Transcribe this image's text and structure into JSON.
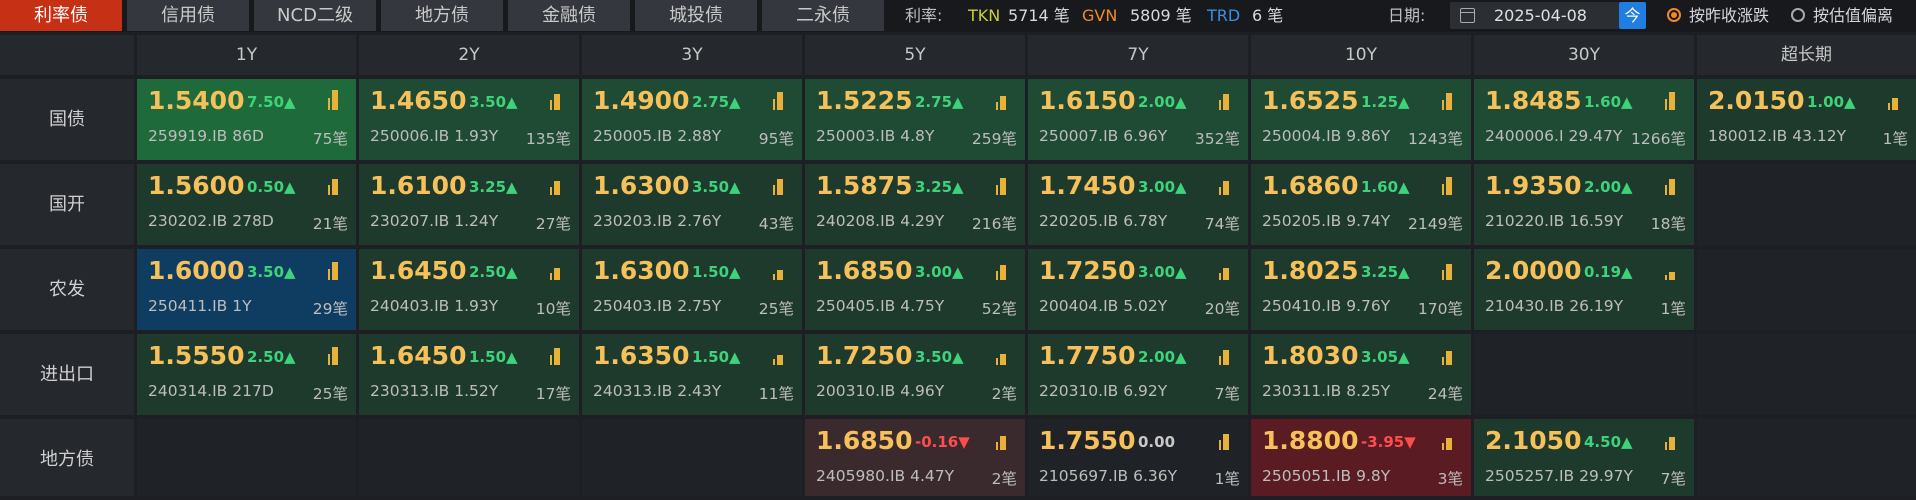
{
  "tabs": [
    {
      "label": "利率债",
      "active": true
    },
    {
      "label": "信用债"
    },
    {
      "label": "NCD二级"
    },
    {
      "label": "地方债"
    },
    {
      "label": "金融债"
    },
    {
      "label": "城投债"
    },
    {
      "label": "二永债"
    }
  ],
  "rate": {
    "label": "利率:",
    "tkn": {
      "name": "TKN",
      "count": "5714 笔"
    },
    "gvn": {
      "name": "GVN",
      "count": "5809 笔"
    },
    "trd": {
      "name": "TRD",
      "count": "6 笔"
    }
  },
  "date": {
    "label": "日期:",
    "value": "2025-04-08",
    "today_label": "今"
  },
  "sort": {
    "option1": "按昨收涨跌",
    "option2": "按估值偏离",
    "selected": "option1"
  },
  "columns": [
    "1Y",
    "2Y",
    "3Y",
    "5Y",
    "7Y",
    "10Y",
    "30Y",
    "超长期"
  ],
  "rows": [
    {
      "name": "国债",
      "cells": [
        {
          "yield": "1.5400",
          "change": "7.50▲",
          "code": "259919.IB 86D",
          "count": "75笔",
          "tone": "bright",
          "bar": 1.0
        },
        {
          "yield": "1.4650",
          "change": "3.50▲",
          "code": "250006.IB 1.93Y",
          "count": "135笔",
          "tone": "green",
          "bar": 0.8
        },
        {
          "yield": "1.4900",
          "change": "2.75▲",
          "code": "250005.IB 2.88Y",
          "count": "95笔",
          "tone": "green",
          "bar": 0.9
        },
        {
          "yield": "1.5225",
          "change": "2.75▲",
          "code": "250003.IB 4.8Y",
          "count": "259笔",
          "tone": "green",
          "bar": 0.7
        },
        {
          "yield": "1.6150",
          "change": "2.00▲",
          "code": "250007.IB 6.96Y",
          "count": "352笔",
          "tone": "green",
          "bar": 0.8
        },
        {
          "yield": "1.6525",
          "change": "1.25▲",
          "code": "250004.IB 9.86Y",
          "count": "1243笔",
          "tone": "green",
          "bar": 0.85
        },
        {
          "yield": "1.8485",
          "change": "1.60▲",
          "code": "2400006.I 29.47Y",
          "count": "1266笔",
          "tone": "green",
          "bar": 0.9
        },
        {
          "yield": "2.0150",
          "change": "1.00▲",
          "code": "180012.IB 43.12Y",
          "count": "1笔",
          "tone": "dark",
          "bar": 0.6
        }
      ]
    },
    {
      "name": "国开",
      "cells": [
        {
          "yield": "1.5600",
          "change": "0.50▲",
          "code": "230202.IB 278D",
          "count": "21笔",
          "tone": "dark",
          "bar": 0.8
        },
        {
          "yield": "1.6100",
          "change": "3.25▲",
          "code": "230207.IB 1.24Y",
          "count": "27笔",
          "tone": "dark",
          "bar": 0.7
        },
        {
          "yield": "1.6300",
          "change": "3.50▲",
          "code": "230203.IB 2.76Y",
          "count": "43笔",
          "tone": "dark",
          "bar": 0.8
        },
        {
          "yield": "1.5875",
          "change": "3.25▲",
          "code": "240208.IB 4.29Y",
          "count": "216笔",
          "tone": "dark",
          "bar": 0.85
        },
        {
          "yield": "1.7450",
          "change": "3.00▲",
          "code": "220205.IB 6.78Y",
          "count": "74笔",
          "tone": "dark",
          "bar": 0.7
        },
        {
          "yield": "1.6860",
          "change": "1.60▲",
          "code": "250205.IB 9.74Y",
          "count": "2149笔",
          "tone": "dark",
          "bar": 0.9
        },
        {
          "yield": "1.9350",
          "change": "2.00▲",
          "code": "210220.IB 16.59Y",
          "count": "18笔",
          "tone": "dark",
          "bar": 0.8
        },
        null
      ]
    },
    {
      "name": "农发",
      "cells": [
        {
          "yield": "1.6000",
          "change": "3.50▲",
          "code": "250411.IB 1Y",
          "count": "29笔",
          "tone": "blue",
          "bar": 0.9
        },
        {
          "yield": "1.6450",
          "change": "2.50▲",
          "code": "240403.IB 1.93Y",
          "count": "10笔",
          "tone": "dark",
          "bar": 0.6
        },
        {
          "yield": "1.6300",
          "change": "1.50▲",
          "code": "250403.IB 2.75Y",
          "count": "25笔",
          "tone": "dark",
          "bar": 0.5
        },
        {
          "yield": "1.6850",
          "change": "3.00▲",
          "code": "250405.IB 4.75Y",
          "count": "52笔",
          "tone": "dark",
          "bar": 0.75
        },
        {
          "yield": "1.7250",
          "change": "3.00▲",
          "code": "200404.IB 5.02Y",
          "count": "20笔",
          "tone": "dark",
          "bar": 0.6
        },
        {
          "yield": "1.8025",
          "change": "3.25▲",
          "code": "250410.IB 9.76Y",
          "count": "170笔",
          "tone": "dark",
          "bar": 0.8
        },
        {
          "yield": "2.0000",
          "change": "0.19▲",
          "code": "210430.IB 26.19Y",
          "count": "1笔",
          "tone": "dark",
          "bar": 0.4
        },
        null
      ]
    },
    {
      "name": "进出口",
      "cells": [
        {
          "yield": "1.5550",
          "change": "2.50▲",
          "code": "240314.IB 217D",
          "count": "25笔",
          "tone": "dark",
          "bar": 0.9
        },
        {
          "yield": "1.6450",
          "change": "1.50▲",
          "code": "230313.IB 1.52Y",
          "count": "17笔",
          "tone": "dark",
          "bar": 0.85
        },
        {
          "yield": "1.6350",
          "change": "1.50▲",
          "code": "240313.IB 2.43Y",
          "count": "11笔",
          "tone": "dark",
          "bar": 0.5
        },
        {
          "yield": "1.7250",
          "change": "3.50▲",
          "code": "200310.IB 4.96Y",
          "count": "2笔",
          "tone": "dark",
          "bar": 0.55
        },
        {
          "yield": "1.7750",
          "change": "2.00▲",
          "code": "220310.IB 6.92Y",
          "count": "7笔",
          "tone": "dark",
          "bar": 0.75
        },
        {
          "yield": "1.8030",
          "change": "3.05▲",
          "code": "230311.IB 8.25Y",
          "count": "24笔",
          "tone": "dark",
          "bar": 0.7
        },
        null,
        null
      ]
    },
    {
      "name": "地方债",
      "cells": [
        null,
        null,
        null,
        {
          "yield": "1.6850",
          "change": "-0.16▼",
          "code": "2405980.IB 4.47Y",
          "count": "2笔",
          "tone": "rose",
          "bar": 0.7
        },
        {
          "yield": "1.7550",
          "change": "0.00",
          "code": "2105697.IB 6.36Y",
          "count": "1笔",
          "tone": "empty",
          "bar": 0.8
        },
        {
          "yield": "1.8800",
          "change": "-3.95▼",
          "code": "2505051.IB 9.8Y",
          "count": "3笔",
          "tone": "red",
          "bar": 0.6
        },
        {
          "yield": "2.1050",
          "change": "4.50▲",
          "code": "2505257.IB 29.97Y",
          "count": "7笔",
          "tone": "dark",
          "bar": 0.65
        },
        null
      ]
    }
  ]
}
